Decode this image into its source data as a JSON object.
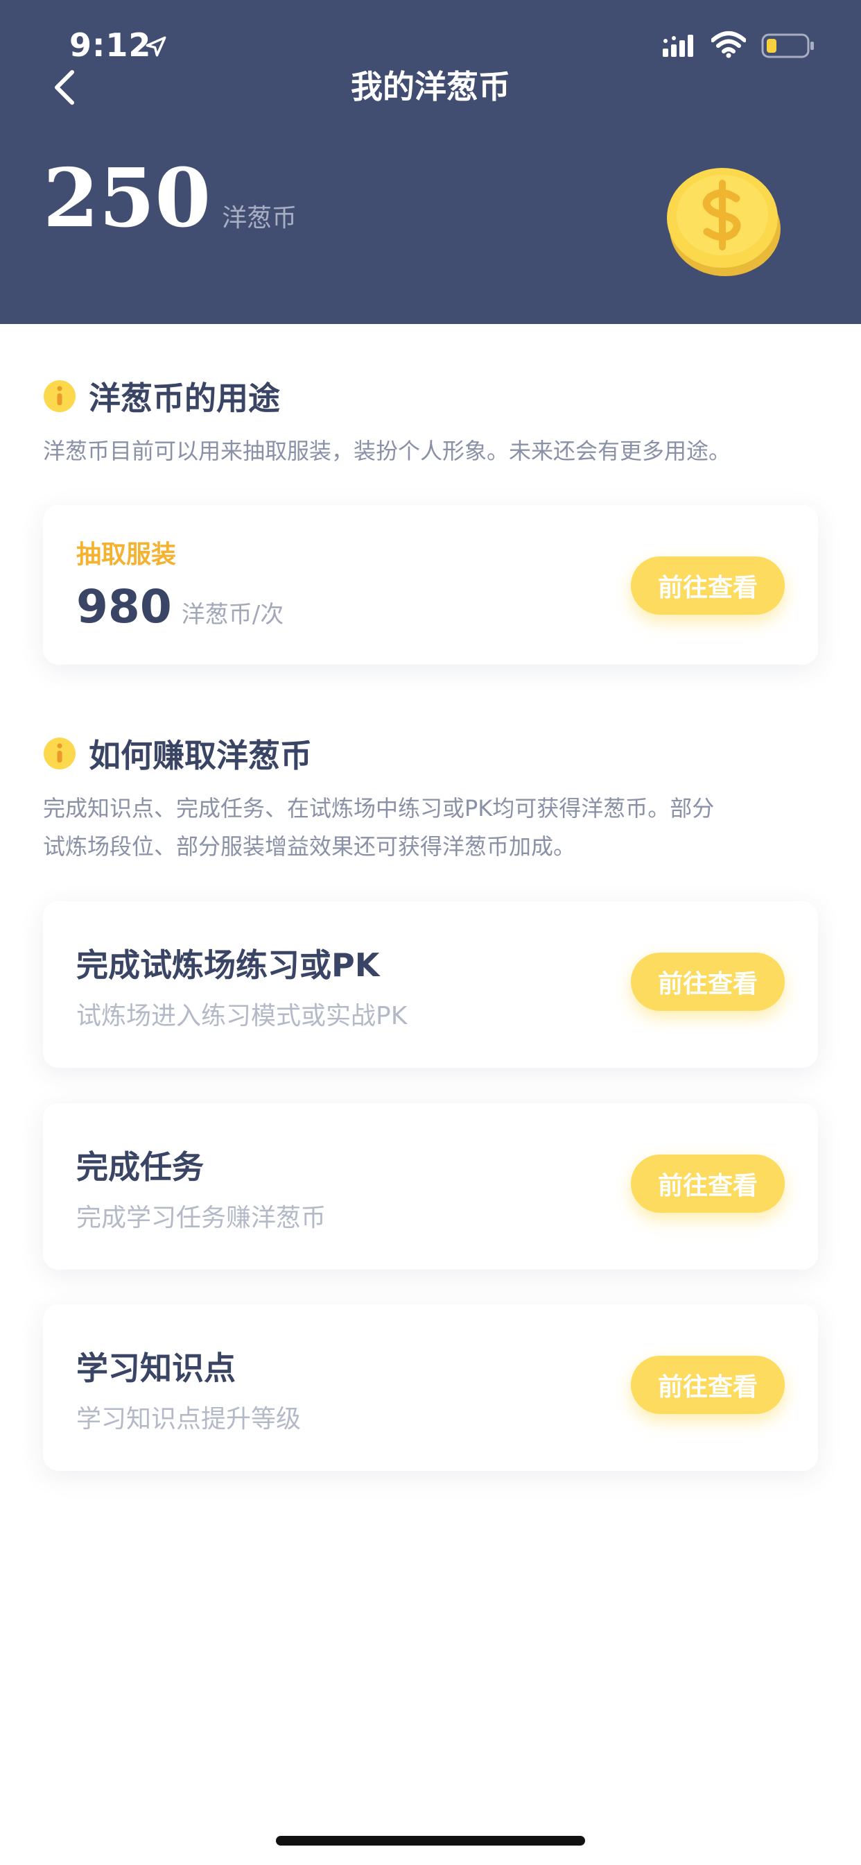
{
  "status_bar": {
    "time": "9:12"
  },
  "header": {
    "title": "我的洋葱币",
    "balance": "250",
    "balance_unit": "洋葱币"
  },
  "usage_section": {
    "title": "洋葱币的用途",
    "description": "洋葱币目前可以用来抽取服装，装扮个人形象。未来还会有更多用途。",
    "card": {
      "label": "抽取服装",
      "price": "980",
      "price_unit": "洋葱币/次",
      "button": "前往查看"
    }
  },
  "earn_section": {
    "title": "如何赚取洋葱币",
    "description_line1": "完成知识点、完成任务、在试炼场中练习或PK均可获得洋葱币。部分",
    "description_line2": "试炼场段位、部分服装增益效果还可获得洋葱币加成。",
    "items": [
      {
        "title": "完成试炼场练习或PK",
        "subtitle": "试炼场进入练习模式或实战PK",
        "button": "前往查看"
      },
      {
        "title": "完成任务",
        "subtitle": "完成学习任务赚洋葱币",
        "button": "前往查看"
      },
      {
        "title": "学习知识点",
        "subtitle": "学习知识点提升等级",
        "button": "前往查看"
      }
    ]
  },
  "colors": {
    "header_bg": "#424e71",
    "accent_yellow": "#fcdb5e",
    "label_orange": "#f5b231",
    "text_dark": "#3a4565",
    "text_muted": "#8a91a6"
  },
  "icons": [
    "back-icon",
    "location-arrow-icon",
    "signal-icon",
    "wifi-icon",
    "battery-icon",
    "coin-icon",
    "info-icon"
  ]
}
